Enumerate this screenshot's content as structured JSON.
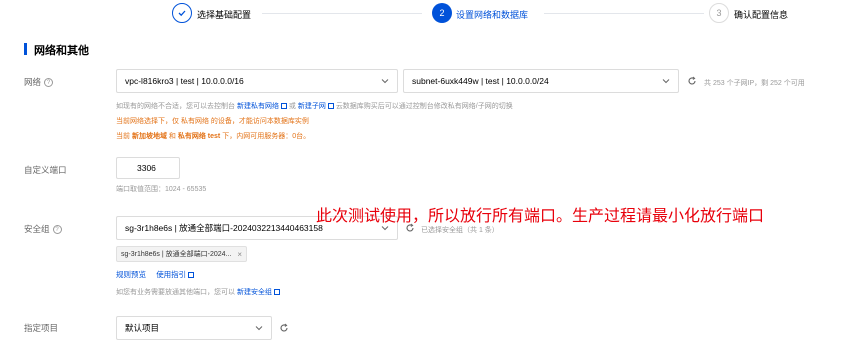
{
  "stepper": {
    "step1": {
      "label": "选择基础配置",
      "status": "done"
    },
    "step2": {
      "number": "2",
      "label": "设置网络和数据库",
      "status": "active"
    },
    "step3": {
      "number": "3",
      "label": "确认配置信息",
      "status": "pending"
    }
  },
  "section": {
    "title": "网络和其他"
  },
  "network": {
    "label": "网络",
    "help": "?",
    "vpc_value": "vpc-l816kro3 | test | 10.0.0.0/16",
    "subnet_value": "subnet-6uxk449w | test | 10.0.0.0/24",
    "ip_info": "共 253 个子网IP，剩 252 个可用",
    "hint_prefix": "如现有的网络不合适，您可以去控制台",
    "hint_link1": "新建私有网络",
    "hint_mid": "或",
    "hint_link2": "新建子网",
    "hint_suffix": "云数据库购买后可以通过控制台修改私有网络/子网的切换",
    "warn1": "当前网络选择下，仅 私有网络 的设备，才能访问本数据库实例",
    "warn2_prefix": "当前",
    "warn2_b1": "新加坡地域",
    "warn2_mid": "和",
    "warn2_b2": "私有网络 test",
    "warn2_suffix": "下，内网可用服务器：0台。"
  },
  "port": {
    "label": "自定义端口",
    "value": "3306",
    "hint": "端口取值范围：1024 - 65535"
  },
  "security": {
    "label": "安全组",
    "help": "?",
    "select_value": "sg-3r1h8e6s | 放通全部端口-20240322134404631​58",
    "selected_count": "已选择安全组（共 1 条）",
    "tag": "sg-3r1h8e6s | 放通全部端口-2024...",
    "tag_close": "×",
    "link_preview": "规则预览",
    "link_guide": "使用指引",
    "hint_prefix": "如您有业务需要放通其他端口，您可以",
    "hint_link": "新建安全组"
  },
  "project": {
    "label": "指定项目",
    "value": "默认项目"
  },
  "annotation": "此次测试使用，所以放行所有端口。生产过程请最小化放行端口",
  "colors": {
    "primary": "#0052d9",
    "warning": "#e37318",
    "annotation": "#e8000b"
  }
}
